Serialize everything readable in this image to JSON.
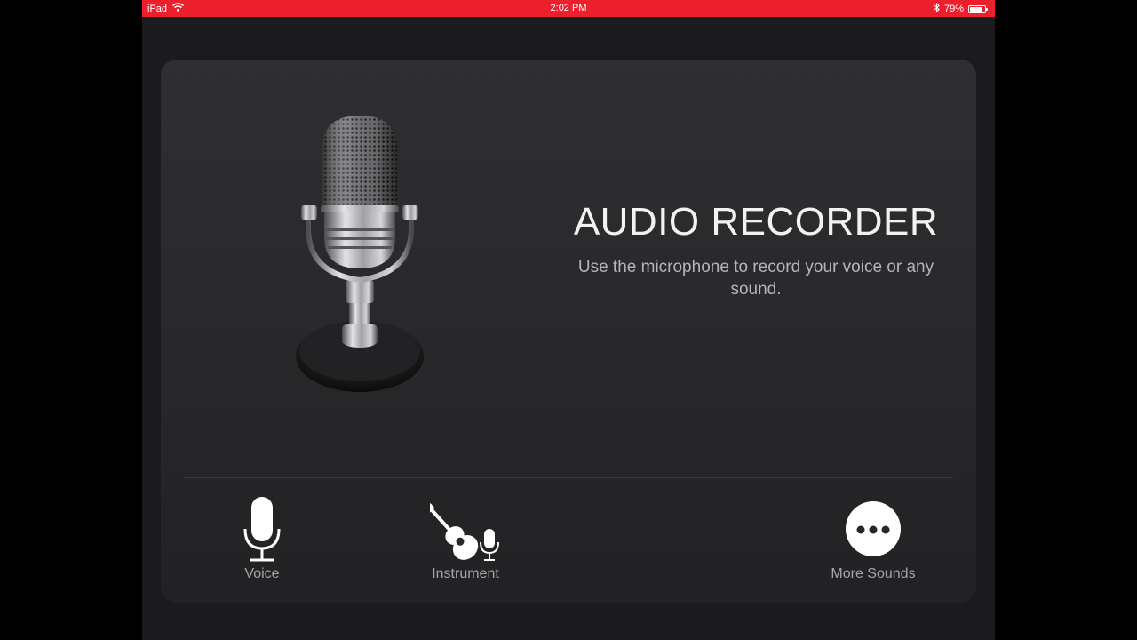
{
  "status_bar": {
    "device": "iPad",
    "time": "2:02 PM",
    "battery": "79%",
    "battery_level": 0.79
  },
  "recorder": {
    "title": "AUDIO RECORDER",
    "description": "Use the microphone to record your voice or any sound."
  },
  "options": {
    "voice_label": "Voice",
    "instrument_label": "Instrument",
    "more_label": "More Sounds"
  },
  "icons": {
    "status": [
      "wifi-icon",
      "bluetooth-icon",
      "battery-icon"
    ],
    "illustration": "microphone-illustration",
    "options": [
      "voice-mic-icon",
      "guitar-mic-icon",
      "more-dots-icon"
    ]
  },
  "colors": {
    "status_bar": "#ec1f2d",
    "background": "#1b1b1d",
    "card": "#2b2b2e",
    "title": "#f2f2f2",
    "label": "#a6a6a9"
  }
}
